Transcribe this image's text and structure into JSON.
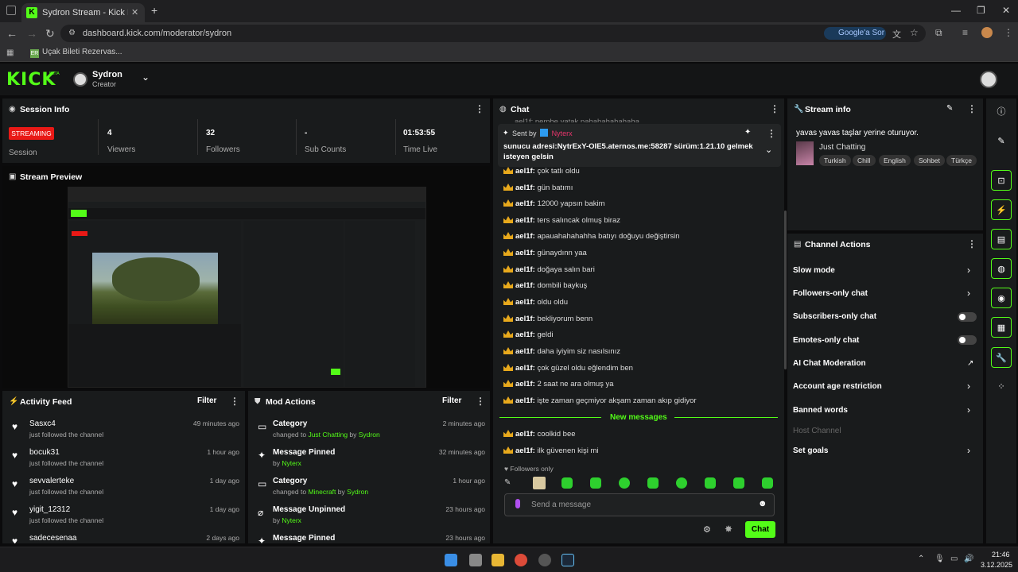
{
  "browser": {
    "tab_title": "Sydron Stream - Kick Dashboard",
    "tab_favicon": "K",
    "close": "✕",
    "new_tab": "+",
    "url": "dashboard.kick.com/moderator/sydron",
    "google_sor": "Google'a Sor",
    "bookmark_label": "Uçak Bileti Rezervas...",
    "bookmark_icon_text": "ER",
    "win_min": "—",
    "win_max": "❐",
    "win_close": "✕"
  },
  "header": {
    "logo": "KICK",
    "beta": "BETA",
    "user_name": "Sydron",
    "user_role": "Creator"
  },
  "session": {
    "title": "Session Info",
    "badge": "STREAMING",
    "session_label": "Session",
    "stats": [
      {
        "value": "4",
        "label": "Viewers"
      },
      {
        "value": "32",
        "label": "Followers"
      },
      {
        "value": "-",
        "label": "Sub Counts"
      },
      {
        "value": "01:53:55",
        "label": "Time Live"
      }
    ]
  },
  "preview": {
    "title": "Stream Preview"
  },
  "activity": {
    "title": "Activity Feed",
    "filter": "Filter",
    "items": [
      {
        "name": "Sasxc4",
        "sub": "just followed the channel",
        "time": "49 minutes ago"
      },
      {
        "name": "bocuk31",
        "sub": "just followed the channel",
        "time": "1 hour ago"
      },
      {
        "name": "sevvalerteke",
        "sub": "just followed the channel",
        "time": "1 day ago"
      },
      {
        "name": "yigit_12312",
        "sub": "just followed the channel",
        "time": "1 day ago"
      },
      {
        "name": "sadecesenaa",
        "sub": "",
        "time": "2 days ago"
      }
    ]
  },
  "mod_actions": {
    "title": "Mod Actions",
    "filter": "Filter",
    "items": [
      {
        "name": "Category",
        "pre": "changed to ",
        "target": "Just Chatting",
        "mid": " by ",
        "by": "Sydron",
        "time": "2 minutes ago",
        "icon": "▭"
      },
      {
        "name": "Message Pinned",
        "pre": "by ",
        "target": "",
        "mid": "",
        "by": "Nyterx",
        "time": "32 minutes ago",
        "icon": "📌"
      },
      {
        "name": "Category",
        "pre": "changed to ",
        "target": "Minecraft",
        "mid": " by ",
        "by": "Sydron",
        "time": "1 hour ago",
        "icon": "▭"
      },
      {
        "name": "Message Unpinned",
        "pre": "by ",
        "target": "",
        "mid": "",
        "by": "Nyterx",
        "time": "23 hours ago",
        "icon": "⌀"
      },
      {
        "name": "Message Pinned",
        "pre": "",
        "target": "",
        "mid": "",
        "by": "",
        "time": "23 hours ago",
        "icon": "📌"
      }
    ]
  },
  "chat": {
    "title": "Chat",
    "cut_line": "ael1f: pembe yatak pahahahahahaha",
    "pinned_by_label": "Sent by",
    "pinned_by": "Nyterx",
    "pinned_text": "sunucu adresi:NytrExY-OIE5.aternos.me:58287 sürüm:1.21.10 gelmek isteyen gelsin",
    "messages": [
      {
        "user": "ael1f:",
        "text": "çok tatlı oldu"
      },
      {
        "user": "ael1f:",
        "text": "gün batımı"
      },
      {
        "user": "ael1f:",
        "text": "12000 yapsın bakim"
      },
      {
        "user": "ael1f:",
        "text": "ters salıncak olmuş biraz"
      },
      {
        "user": "ael1f:",
        "text": "apauahahahahha batıyı doğuyu değiştirsin"
      },
      {
        "user": "ael1f:",
        "text": "günaydınn yaa"
      },
      {
        "user": "ael1f:",
        "text": "doğaya salın bari"
      },
      {
        "user": "ael1f:",
        "text": "dombili baykuş"
      },
      {
        "user": "ael1f:",
        "text": "oldu oldu"
      },
      {
        "user": "ael1f:",
        "text": "bekliyorum benn"
      },
      {
        "user": "ael1f:",
        "text": "geldi"
      },
      {
        "user": "ael1f:",
        "text": "daha iyiyim siz nasılsınız"
      },
      {
        "user": "ael1f:",
        "text": "çok güzel oldu eğlendim ben"
      },
      {
        "user": "ael1f:",
        "text": "2 saat ne ara olmuş ya"
      },
      {
        "user": "ael1f:",
        "text": "işte zaman geçmiyor akşam zaman akıp gidiyor"
      }
    ],
    "new_messages_label": "New messages",
    "new_messages": [
      {
        "user": "ael1f:",
        "text": "coolkid bee"
      },
      {
        "user": "ael1f:",
        "text": "ilk güvenen kişi mi"
      }
    ],
    "followers_only": "Followers only",
    "input_placeholder": "Send a message",
    "send": "Chat"
  },
  "stream_info": {
    "title": "Stream info",
    "stream_title": "yavas yavas taşlar yerine oturuyor.",
    "category": "Just Chatting",
    "tags": [
      "Turkish",
      "Chill",
      "English",
      "Sohbet",
      "Türkçe"
    ]
  },
  "channel_actions": {
    "title": "Channel Actions",
    "items": [
      {
        "label": "Slow mode",
        "control": "chevron"
      },
      {
        "label": "Followers-only chat",
        "control": "chevron"
      },
      {
        "label": "Subscribers-only chat",
        "control": "toggle"
      },
      {
        "label": "Emotes-only chat",
        "control": "toggle"
      },
      {
        "label": "AI Chat Moderation",
        "control": "external"
      },
      {
        "label": "Account age restriction",
        "control": "chevron"
      },
      {
        "label": "Banned words",
        "control": "chevron"
      },
      {
        "label": "Host Channel",
        "control": "none"
      },
      {
        "label": "Set goals",
        "control": "chevron"
      }
    ]
  },
  "taskbar": {
    "time": "21:46",
    "date": "3.12.2025"
  },
  "colors": {
    "brand": "#53fc18",
    "live": "#e91916",
    "crown": "#e8a91c",
    "panel": "#191b1c"
  }
}
